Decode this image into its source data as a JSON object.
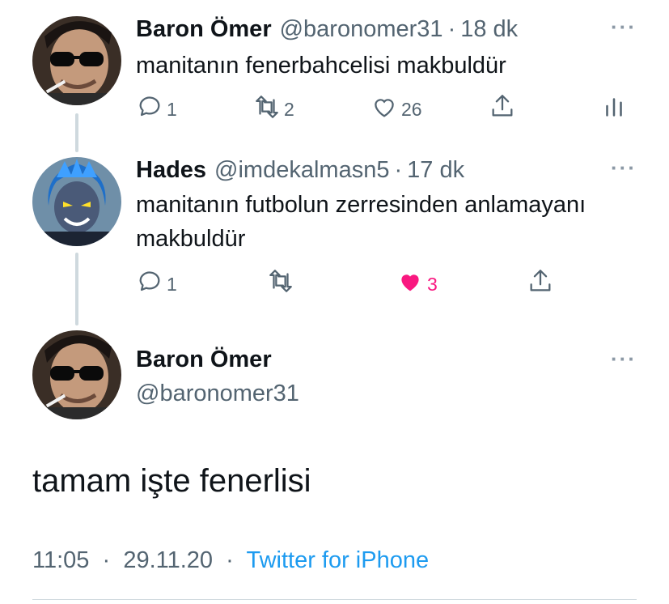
{
  "tweets": [
    {
      "name": "Baron Ömer",
      "handle": "@baronomer31",
      "time": "18 dk",
      "text": "manitanın fenerbahcelisi makbuldür",
      "replies": "1",
      "retweets": "2",
      "likes": "26",
      "avatar_icon": "profile-photo-sunglasses-cigarette"
    },
    {
      "name": "Hades",
      "handle": "@imdekalmasn5",
      "time": "17 dk",
      "text_line1": "manitanın futbolun zerresinden anlamayanı",
      "text_line2": "makbuldür",
      "replies": "1",
      "likes": "3",
      "avatar_icon": "profile-photo-hades-cartoon"
    }
  ],
  "main_tweet": {
    "name": "Baron Ömer",
    "handle": "@baronomer31",
    "text": "tamam işte fenerlisi",
    "time": "11:05",
    "date": "29.11.20",
    "source": "Twitter for iPhone"
  },
  "separator": "·",
  "more_icon": "···",
  "colors": {
    "like_active": "#f91880",
    "link": "#1d9bf0",
    "secondary_text": "#536471",
    "thread_line": "#cfd9de"
  }
}
